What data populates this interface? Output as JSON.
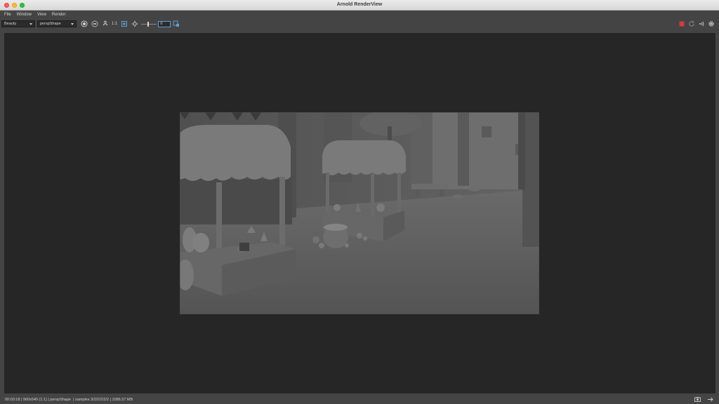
{
  "window": {
    "title": "Arnold RenderView"
  },
  "menu": [
    "File",
    "Window",
    "View",
    "Render"
  ],
  "toolbar": {
    "aov": "Beauty",
    "camera": "perspShape",
    "zoom_label": "1:1",
    "exposure_value": "0"
  },
  "status": {
    "text": "00:00:18 | 960x540 (1:1) | perspShape  | samples 3/2/2/2/2/2 | 1086.57 MB"
  },
  "icons": {
    "toolbar_left": [
      "render-region-icon",
      "display-icon",
      "aov-arrows-icon",
      "crop-icon",
      "exposure-sun-icon",
      "color-picker-icon"
    ],
    "toolbar_right": [
      "stop-render-icon",
      "refresh-render-icon",
      "ipr-broadcast-icon",
      "settings-gear-icon"
    ],
    "status_right": [
      "snapshot-camera-icon",
      "expand-panel-icon"
    ]
  },
  "colors": {
    "stop": "#d23b3b",
    "accent": "#5aa0d6",
    "viewport_bg": "#262626",
    "ui_bg": "#444444"
  }
}
